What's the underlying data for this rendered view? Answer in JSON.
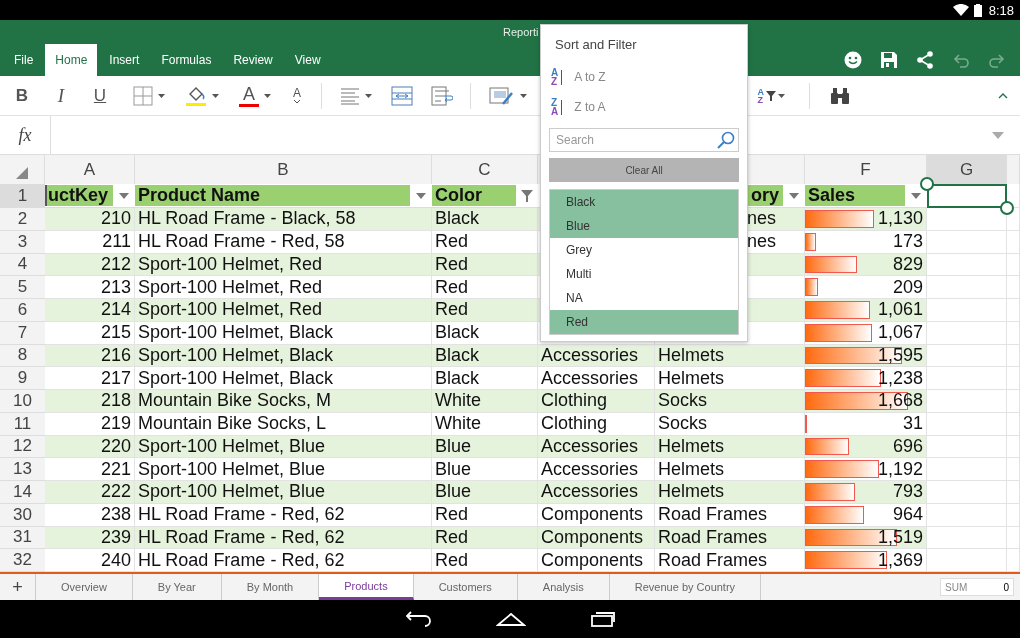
{
  "status_bar": {
    "time": "8:18"
  },
  "title_bar": {
    "title": "Reporti"
  },
  "ribbon_tabs": [
    {
      "label": "File",
      "selected": false
    },
    {
      "label": "Home",
      "selected": true
    },
    {
      "label": "Insert",
      "selected": false
    },
    {
      "label": "Formulas",
      "selected": false
    },
    {
      "label": "Review",
      "selected": false
    },
    {
      "label": "View",
      "selected": false
    }
  ],
  "ribbon_actions": [
    {
      "kind": "smiley",
      "disabled": false
    },
    {
      "kind": "save",
      "disabled": false
    },
    {
      "kind": "share",
      "disabled": false
    },
    {
      "kind": "undo",
      "disabled": true
    },
    {
      "kind": "redo",
      "disabled": true
    }
  ],
  "toolbar": {
    "bold": "B",
    "italic": "I",
    "underline": "U",
    "font_color": "A",
    "font_size": "A",
    "sort_glyphs": [
      "A",
      "Z"
    ]
  },
  "formula_bar": {
    "label": "fx"
  },
  "columns": [
    {
      "kind": "letter",
      "letter": "A",
      "selected": false
    },
    {
      "kind": "letter",
      "letter": "B",
      "selected": false
    },
    {
      "kind": "letter",
      "letter": "C",
      "selected": false
    },
    {
      "kind": "covered"
    },
    {
      "kind": "covered"
    },
    {
      "kind": "letter",
      "letter": "F",
      "selected": false
    },
    {
      "kind": "letter",
      "letter": "G",
      "selected": true
    }
  ],
  "header_row": {
    "number": "1",
    "selected": true,
    "cells": [
      {
        "text": "uctKey",
        "kind": "dropdown"
      },
      {
        "text": "Product Name",
        "kind": "dropdown"
      },
      {
        "text": "Color",
        "kind": "funnel"
      },
      {
        "kind": "covered"
      },
      {
        "text": "ory",
        "kind": "dropdown",
        "cut": true
      },
      {
        "text": "Sales",
        "kind": "dropdown"
      }
    ]
  },
  "rows": [
    {
      "number": "2",
      "key": "210",
      "name": "HL Road Frame - Black, 58",
      "product_color": "Black",
      "subcategory": "nes",
      "cut": true,
      "sales": "1,130",
      "level": 0.57
    },
    {
      "number": "3",
      "key": "211",
      "name": "HL Road Frame - Red, 58",
      "product_color": "Red",
      "subcategory": "nes",
      "cut": true,
      "sales": "173",
      "level": 0.09
    },
    {
      "number": "4",
      "key": "212",
      "name": "Sport-100 Helmet, Red",
      "product_color": "Red",
      "sales": "829",
      "level": 0.43
    },
    {
      "number": "5",
      "key": "213",
      "name": "Sport-100 Helmet, Red",
      "product_color": "Red",
      "sales": "209",
      "level": 0.11
    },
    {
      "number": "6",
      "key": "214",
      "name": "Sport-100 Helmet, Red",
      "product_color": "Red",
      "sales": "1,061",
      "level": 0.54
    },
    {
      "number": "7",
      "key": "215",
      "name": "Sport-100 Helmet, Black",
      "product_color": "Black",
      "sales": "1,067",
      "level": 0.55
    },
    {
      "number": "8",
      "key": "216",
      "name": "Sport-100 Helmet, Black",
      "product_color": "Black",
      "category": "Accessories",
      "subcategory": "Helmets",
      "sales": "1,595",
      "level": 0.8
    },
    {
      "number": "9",
      "key": "217",
      "name": "Sport-100 Helmet, Black",
      "product_color": "Black",
      "category": "Accessories",
      "subcategory": "Helmets",
      "sales": "1,238",
      "level": 0.63
    },
    {
      "number": "10",
      "key": "218",
      "name": "Mountain Bike Socks, M",
      "product_color": "White",
      "category": "Clothing",
      "subcategory": "Socks",
      "sales": "1,668",
      "level": 0.85
    },
    {
      "number": "11",
      "key": "219",
      "name": "Mountain Bike Socks, L",
      "product_color": "White",
      "category": "Clothing",
      "subcategory": "Socks",
      "sales": "31",
      "level": 0.02
    },
    {
      "number": "12",
      "key": "220",
      "name": "Sport-100 Helmet, Blue",
      "product_color": "Blue",
      "category": "Accessories",
      "subcategory": "Helmets",
      "sales": "696",
      "level": 0.36
    },
    {
      "number": "13",
      "key": "221",
      "name": "Sport-100 Helmet, Blue",
      "product_color": "Blue",
      "category": "Accessories",
      "subcategory": "Helmets",
      "sales": "1,192",
      "level": 0.61
    },
    {
      "number": "14",
      "key": "222",
      "name": "Sport-100 Helmet, Blue",
      "product_color": "Blue",
      "category": "Accessories",
      "subcategory": "Helmets",
      "sales": "793",
      "level": 0.41
    },
    {
      "number": "30",
      "key": "238",
      "name": "HL Road Frame - Red, 62",
      "product_color": "Red",
      "category": "Components",
      "subcategory": "Road Frames",
      "sales": "964",
      "level": 0.49
    },
    {
      "number": "31",
      "key": "239",
      "name": "HL Road Frame - Red, 62",
      "product_color": "Red",
      "category": "Components",
      "subcategory": "Road Frames",
      "sales": "1,519",
      "level": 0.76
    },
    {
      "number": "32",
      "key": "240",
      "name": "HL Road Frame - Red, 62",
      "product_color": "Red",
      "category": "Components",
      "subcategory": "Road Frames",
      "sales": "1,369",
      "level": 0.68
    }
  ],
  "filter_popup": {
    "title": "Sort and Filter",
    "sort_options": [
      {
        "glyphs": [
          "A",
          "Z"
        ],
        "label": "A to Z"
      },
      {
        "glyphs": [
          "Z",
          "A"
        ],
        "label": "Z to A"
      }
    ],
    "search_placeholder": "Search",
    "clear_label": "Clear All",
    "items": [
      {
        "label": "Black",
        "selected": true
      },
      {
        "label": "Blue",
        "selected": true
      },
      {
        "label": "Grey",
        "selected": false
      },
      {
        "label": "Multi",
        "selected": false
      },
      {
        "label": "NA",
        "selected": false
      },
      {
        "label": "Red",
        "selected": true
      }
    ]
  },
  "sheet_tabs": {
    "add": "+",
    "tabs": [
      {
        "label": "Overview",
        "selected": false
      },
      {
        "label": "By Year",
        "selected": false
      },
      {
        "label": "By Month",
        "selected": false
      },
      {
        "label": "Products",
        "selected": true
      },
      {
        "label": "Customers",
        "selected": false
      },
      {
        "label": "Analysis",
        "selected": false
      },
      {
        "label": "Revenue by Country",
        "selected": false
      }
    ]
  },
  "sum": {
    "label": "SUM",
    "value": "0"
  }
}
